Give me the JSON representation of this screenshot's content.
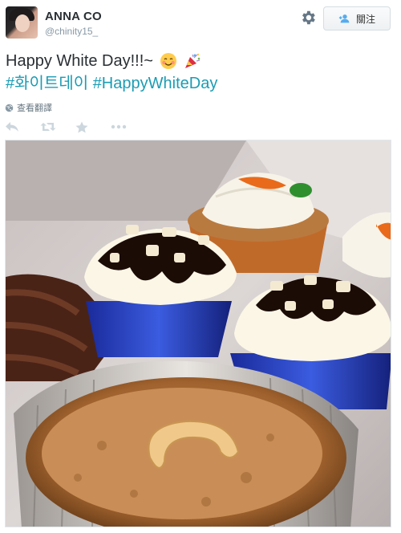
{
  "user": {
    "display_name": "ANNA CO",
    "handle": "@chinity15_"
  },
  "header": {
    "follow_label": "關注",
    "gear_icon": "gear-icon",
    "follow_icon": "person-add-icon"
  },
  "tweet": {
    "text_line1": "Happy White Day!!!~",
    "hashtag_korean": "#화이트데이",
    "hashtag_english": "#HappyWhiteDay",
    "emojis": [
      "smiling-face-icon",
      "party-popper-icon"
    ],
    "hashtag_color": "#1c9cb4",
    "translate_label": "查看翻譯"
  },
  "actions": {
    "icons": [
      "reply-icon",
      "retweet-icon",
      "favorite-icon",
      "more-icon"
    ],
    "icon_color": "#ccd6dd"
  },
  "photo": {
    "subject": "cupcakes"
  }
}
